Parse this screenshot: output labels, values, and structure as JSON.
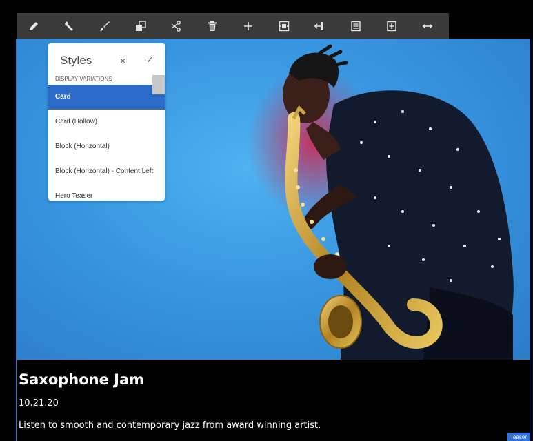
{
  "toolbar": {
    "buttons": [
      {
        "icon": "pencil-icon"
      },
      {
        "icon": "wrench-icon"
      },
      {
        "icon": "brush-icon"
      },
      {
        "icon": "copy-icon"
      },
      {
        "icon": "scissors-icon"
      },
      {
        "icon": "trash-icon"
      },
      {
        "icon": "plus-icon"
      },
      {
        "icon": "group-icon"
      },
      {
        "icon": "parent-icon"
      },
      {
        "icon": "list-icon"
      },
      {
        "icon": "layout-icon"
      },
      {
        "icon": "resize-icon"
      }
    ]
  },
  "styles_popover": {
    "title": "Styles",
    "close_glyph": "×",
    "confirm_glyph": "✓",
    "section_label": "DISPLAY VARIATIONS",
    "options": [
      {
        "label": "Card",
        "selected": true
      },
      {
        "label": "Card (Hollow)",
        "selected": false
      },
      {
        "label": "Block (Horizontal)",
        "selected": false
      },
      {
        "label": "Block (Horizontal) - Content Left",
        "selected": false
      },
      {
        "label": "Hero Teaser",
        "selected": false
      }
    ]
  },
  "teaser": {
    "title": "Saxophone Jam",
    "date": "10.21.20",
    "description": "Listen to smooth and contemporary jazz from award winning artist.",
    "badge": "Teaser"
  },
  "colors": {
    "toolbar_bg": "#3a3a3a",
    "accent_blue": "#2d6bc8",
    "selection_border": "#2f6fe0",
    "hero_bg": "#3896e0"
  }
}
